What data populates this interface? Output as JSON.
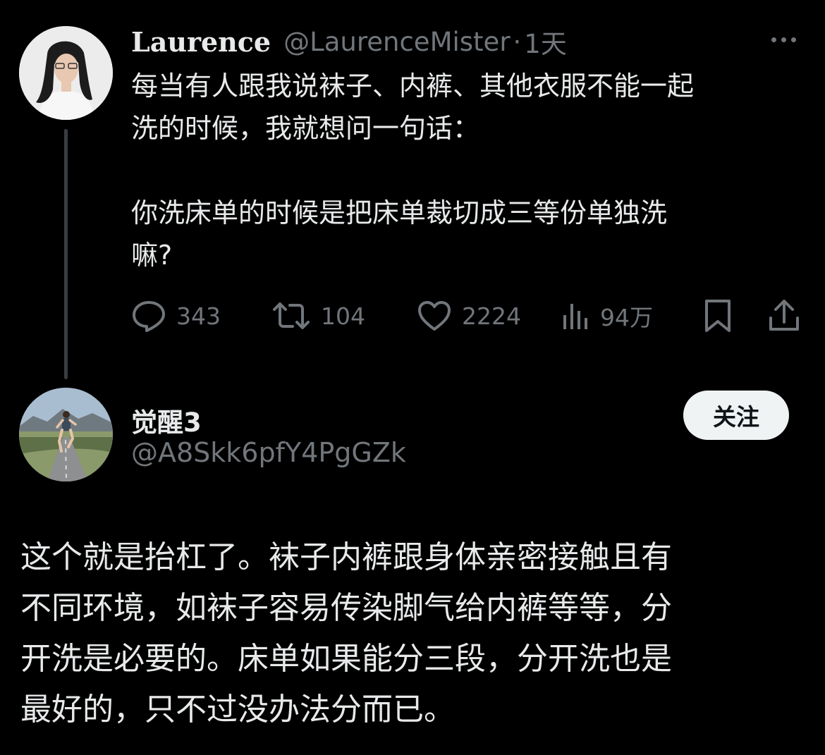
{
  "original_tweet": {
    "author_name": "Laurence",
    "handle": "@LaurenceMister",
    "separator": "·",
    "time": "1天",
    "more_icon": "more-dots-icon",
    "text_lines": [
      "每当有人跟我说袜子、内裤、其他衣服不能一起",
      "洗的时候，我就想问一句话：",
      "你洗床单的时候是把床单裁切成三等份单独洗",
      "嘛?"
    ],
    "actions": {
      "replies": "343",
      "retweets": "104",
      "likes": "2224",
      "views": "94万"
    }
  },
  "reply": {
    "author_name": "觉醒3",
    "handle": "@A8Skk6pfY4PgGZk",
    "follow_label": "关注",
    "text_lines": [
      "这个就是抬杠了。袜子内裤跟身体亲密接触且有",
      "不同环境，如袜子容易传染脚气给内裤等等，分",
      "开洗是必要的。床单如果能分三段，分开洗也是",
      "最好的，只不过没办法分而已。"
    ]
  },
  "colors": {
    "background": "#000000",
    "text_primary": "#e7e9ea",
    "text_secondary": "#71767b",
    "button_bg": "#eff3f4"
  }
}
